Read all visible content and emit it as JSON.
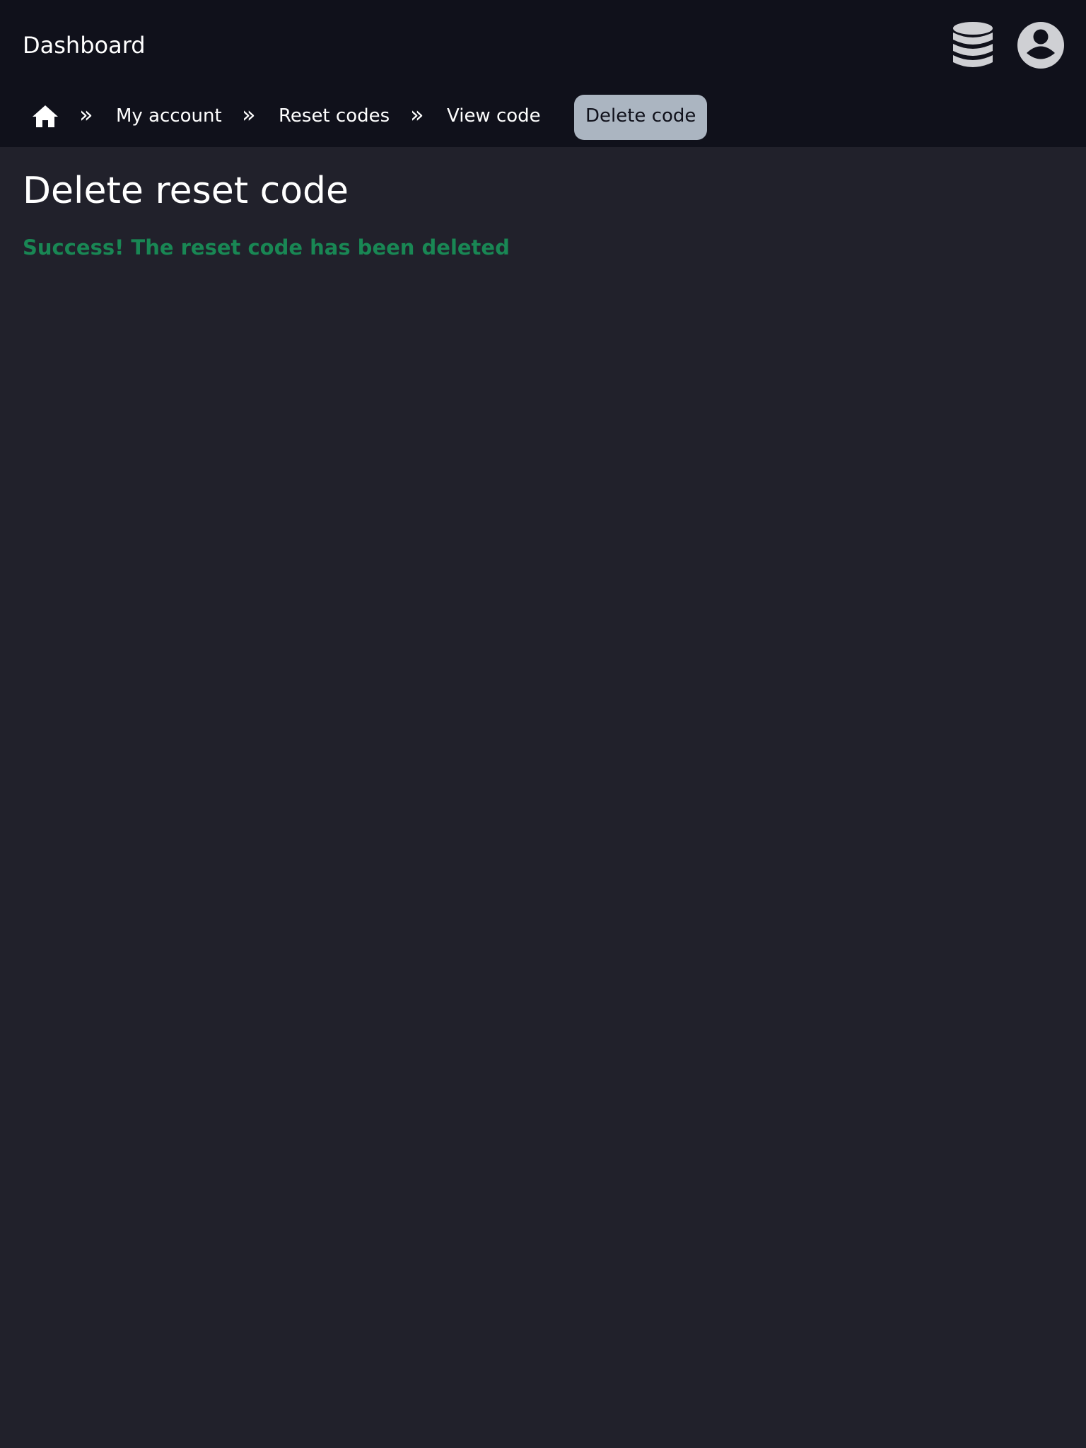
{
  "header": {
    "brand": "Dashboard",
    "icons": {
      "database": "database-icon",
      "user": "user-circle-icon"
    }
  },
  "breadcrumb": {
    "home_icon": "home-icon",
    "separator": "»",
    "items": [
      "My account",
      "Reset codes",
      "View code"
    ],
    "active": "Delete code"
  },
  "main": {
    "title": "Delete reset code",
    "message": "Success! The reset code has been deleted"
  },
  "colors": {
    "topbar": "#10111b",
    "page": "#21212b",
    "active_crumb": "#abb5c1",
    "success": "#198754",
    "icon": "#cfd0d4"
  }
}
